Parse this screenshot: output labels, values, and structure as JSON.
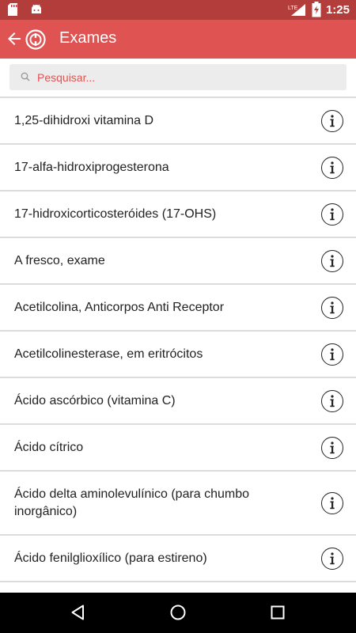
{
  "status_bar": {
    "time": "1:25",
    "network": "LTE",
    "icons": [
      "sd-card-icon",
      "android-icon",
      "signal-icon",
      "battery-charging-icon"
    ]
  },
  "app_bar": {
    "title": "Exames",
    "back_icon": "arrow-back-icon",
    "logo_icon": "app-logo-icon"
  },
  "search": {
    "placeholder": "Pesquisar...",
    "icon": "search-icon"
  },
  "exams": [
    {
      "label": "1,25-dihidroxi vitamina D"
    },
    {
      "label": "17-alfa-hidroxiprogesterona"
    },
    {
      "label": "17-hidroxicorticosteróides (17-OHS)"
    },
    {
      "label": "A fresco, exame"
    },
    {
      "label": "Acetilcolina, Anticorpos Anti Receptor"
    },
    {
      "label": "Acetilcolinesterase, em eritrócitos"
    },
    {
      "label": "Ácido ascórbico (vitamina C)"
    },
    {
      "label": "Ácido cítrico"
    },
    {
      "label": "Ácido delta aminolevulínico (para chumbo inorgânico)"
    },
    {
      "label": "Ácido fenilglioxílico (para estireno)"
    }
  ],
  "info_icon": "info-icon",
  "nav_bar": {
    "icons": [
      "nav-back-icon",
      "nav-home-icon",
      "nav-recents-icon"
    ]
  },
  "colors": {
    "status_bar": "#b23d3a",
    "app_bar": "#e05353",
    "placeholder": "#e05353",
    "divider": "#dcdcdc"
  }
}
